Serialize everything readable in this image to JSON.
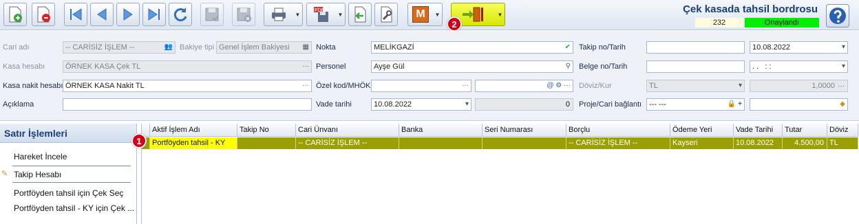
{
  "header": {
    "title": "Çek kasada tahsil bordrosu",
    "doc_number": "232",
    "status": "Onaylandı",
    "pdf_label": "PDF",
    "m_label": "M"
  },
  "badges": {
    "one": "1",
    "two": "2"
  },
  "form": {
    "cari_label": "Cari adı",
    "cari_value": "-- CARİSİZ İŞLEM --",
    "bakiye_label": "Bakiye tipi",
    "bakiye_value": "Genel İşlem Bakiyesi",
    "kasa_label": "Kasa hesabı",
    "kasa_value": "ÖRNEK KASA Çek TL",
    "kasa_nakit_label": "Kasa nakit hesabı",
    "kasa_nakit_value": "ÖRNEK KASA Nakit TL",
    "aciklama_label": "Açıklama",
    "aciklama_value": "",
    "nokta_label": "Nokta",
    "nokta_value": "MELİKGAZİ",
    "personel_label": "Personel",
    "personel_value": "Ayşe Gül",
    "ozel_label": "Özel kod/MHÖK",
    "ozel_value": "",
    "vade_label": "Vade tarihi",
    "vade_value": "10.08.2022",
    "vade_days": "0",
    "takip_label": "Takip no/Tarih",
    "takip_no": "",
    "takip_date": "10.08.2022",
    "belge_label": "Belge no/Tarih",
    "belge_no": "",
    "belge_date": ". .   : :",
    "doviz_label": "Döviz/Kur",
    "doviz_value": "TL",
    "kur_value": "1,0000",
    "proje_label": "Proje/Cari bağlantı",
    "proje_value": "--- ---",
    "proje_value2": ""
  },
  "left_panel": {
    "title": "Satır İşlemleri",
    "items": [
      "Hareket İncele",
      "Takip Hesabı",
      "Portföyden tahsil için Çek Seç",
      "Portföyden tahsil - KY için Çek ..."
    ]
  },
  "grid": {
    "columns": [
      "Aktif İşlem Adı",
      "Takip No",
      "Cari Ünvanı",
      "Banka",
      "Seri Numarası",
      "Borçlu",
      "Ödeme Yeri",
      "Vade Tarihi",
      "Tutar",
      "Döviz"
    ],
    "rows": [
      [
        "Portföyden tahsil - KY",
        "",
        "-- CARİSİZ İŞLEM --",
        "",
        "",
        "-- CARİSİZ İŞLEM --",
        "Kayseri",
        "10.08.2022",
        "4.500,00",
        "TL"
      ]
    ]
  }
}
